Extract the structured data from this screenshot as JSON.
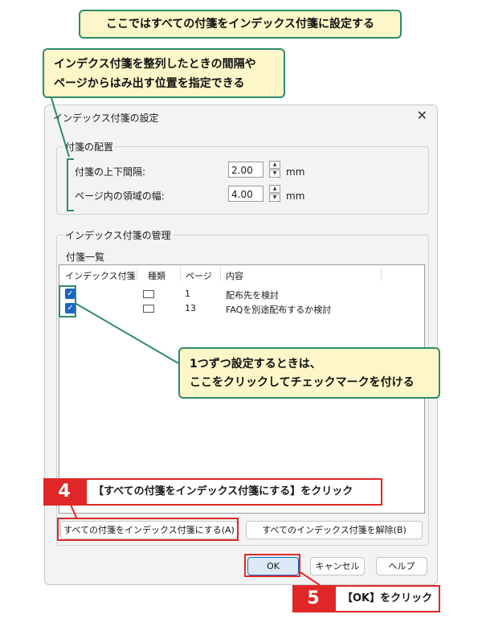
{
  "callouts": {
    "top": "ここではすべての付箋をインデックス付箋に設定する",
    "interval_line1": "インデクス付箋を整列したときの間隔や",
    "interval_line2": "ページからはみ出す位置を指定できる",
    "check_line1": "1つずつ設定するときは、",
    "check_line2": "ここをクリックしてチェックマークを付ける"
  },
  "dialog": {
    "title": "インデックス付箋の設定",
    "close_glyph": "✕",
    "layout_group": {
      "label": "付箋の配置",
      "spacing_label": "付箋の上下間隔:",
      "spacing_value": "2.00",
      "width_label": "ページ内の領域の幅:",
      "width_value": "4.00",
      "unit": "mm",
      "spin_up": "▲",
      "spin_down": "▼"
    },
    "manage_group": {
      "label": "インデックス付箋の管理",
      "list_caption": "付箋一覧",
      "columns": [
        "インデックス付箋",
        "種類",
        "ページ",
        "内容"
      ],
      "rows": [
        {
          "checked": true,
          "type_icon": "sticky-note-icon",
          "page": "1",
          "content": "配布先を検討"
        },
        {
          "checked": true,
          "type_icon": "sticky-note-icon",
          "page": "13",
          "content": "FAQを別途配布するか検討"
        }
      ],
      "check_glyph": "✓",
      "set_all_button": "すべての付箋をインデックス付箋にする(A)",
      "clear_all_button": "すべてのインデックス付箋を解除(B)"
    },
    "ok_button": "OK",
    "cancel_button": "キャンセル",
    "help_button": "ヘルプ"
  },
  "steps": {
    "step4": {
      "number": "4",
      "text": "【すべての付箋をインデックス付箋にする】をクリック"
    },
    "step5": {
      "number": "5",
      "text": "【OK】をクリック"
    }
  },
  "colors": {
    "callout_bg": "#fdf6c8",
    "callout_border": "#2e8b6a",
    "step_red": "#e02727",
    "checkbox_blue": "#1866c4"
  }
}
